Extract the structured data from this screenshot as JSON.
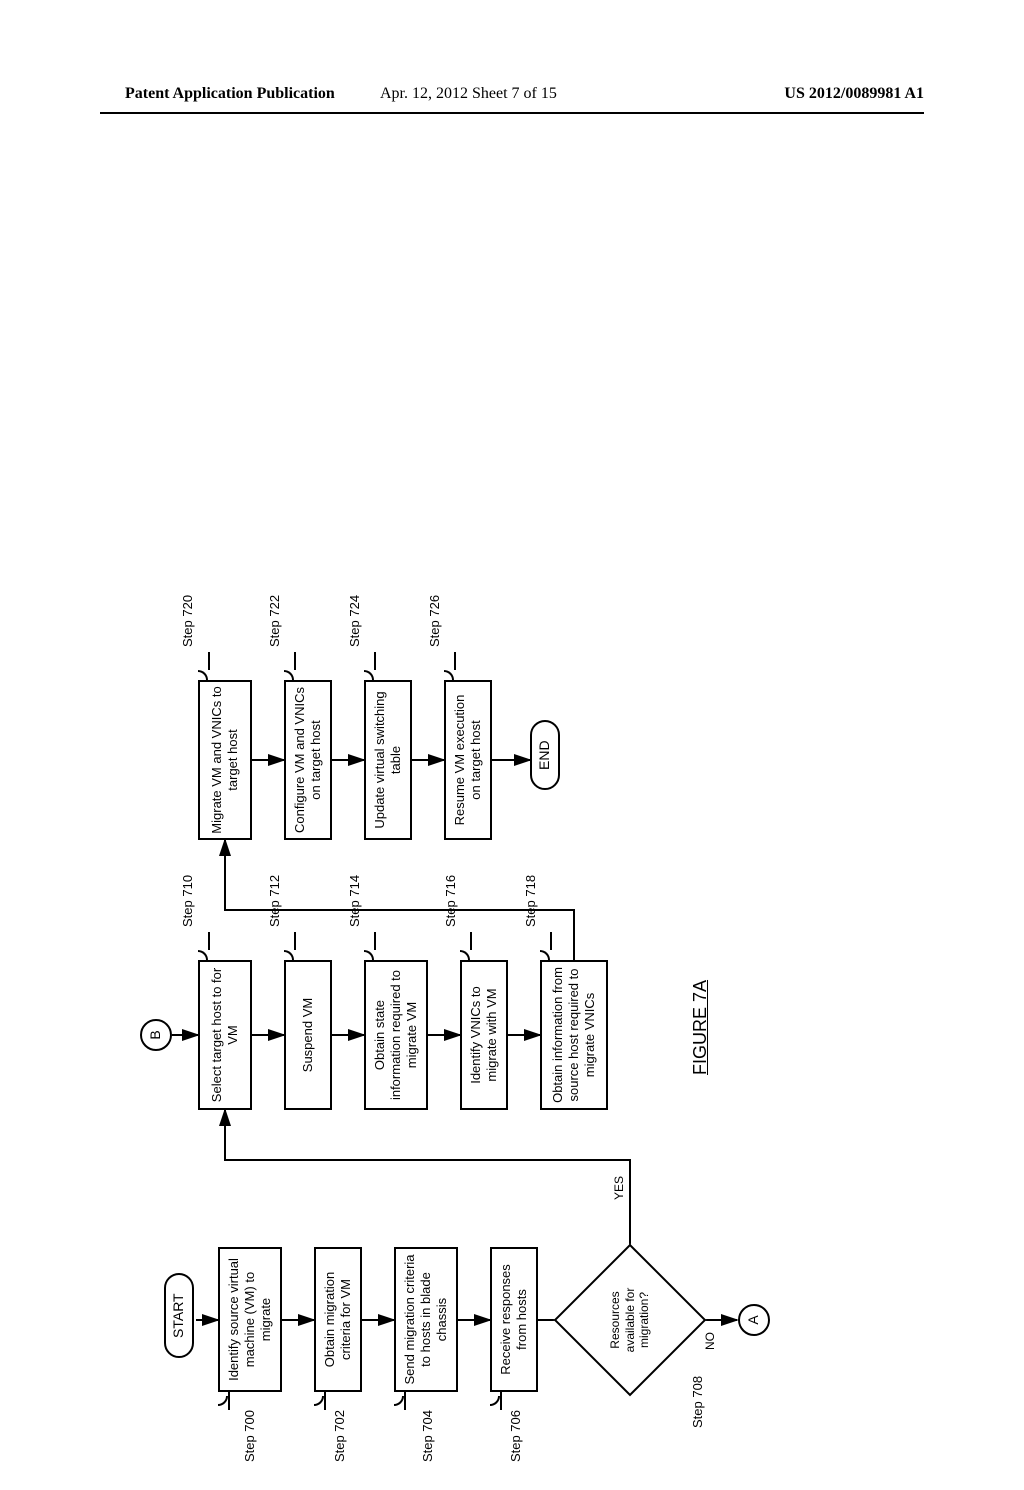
{
  "header": {
    "left": "Patent Application Publication",
    "center": "Apr. 12, 2012  Sheet 7 of 15",
    "right": "US 2012/0089981 A1"
  },
  "figure_label": "FIGURE 7A",
  "terminators": {
    "start": "START",
    "end": "END"
  },
  "connectors": {
    "A": "A",
    "B": "B"
  },
  "edge_labels": {
    "yes": "YES",
    "no": "NO"
  },
  "decision": {
    "text": "Resources available for migration?",
    "step": "Step 708"
  },
  "col1": [
    {
      "step": "Step 700",
      "text": "Identify source virtual machine (VM) to migrate"
    },
    {
      "step": "Step 702",
      "text": "Obtain migration criteria for VM"
    },
    {
      "step": "Step 704",
      "text": "Send migration criteria to hosts in blade chassis"
    },
    {
      "step": "Step 706",
      "text": "Receive responses from hosts"
    }
  ],
  "col2": [
    {
      "step": "Step 710",
      "text": "Select target host to for VM"
    },
    {
      "step": "Step 712",
      "text": "Suspend VM"
    },
    {
      "step": "Step 714",
      "text": "Obtain state information required to migrate VM"
    },
    {
      "step": "Step 716",
      "text": "Identify VNICs to migrate with VM"
    },
    {
      "step": "Step 718",
      "text": "Obtain information from source host required to migrate VNICs"
    }
  ],
  "col3": [
    {
      "step": "Step 720",
      "text": "Migrate VM and VNICs to target host"
    },
    {
      "step": "Step 722",
      "text": "Configure VM and VNICs on target host"
    },
    {
      "step": "Step 724",
      "text": "Update virtual switching table"
    },
    {
      "step": "Step 726",
      "text": "Resume VM execution on target host"
    }
  ]
}
